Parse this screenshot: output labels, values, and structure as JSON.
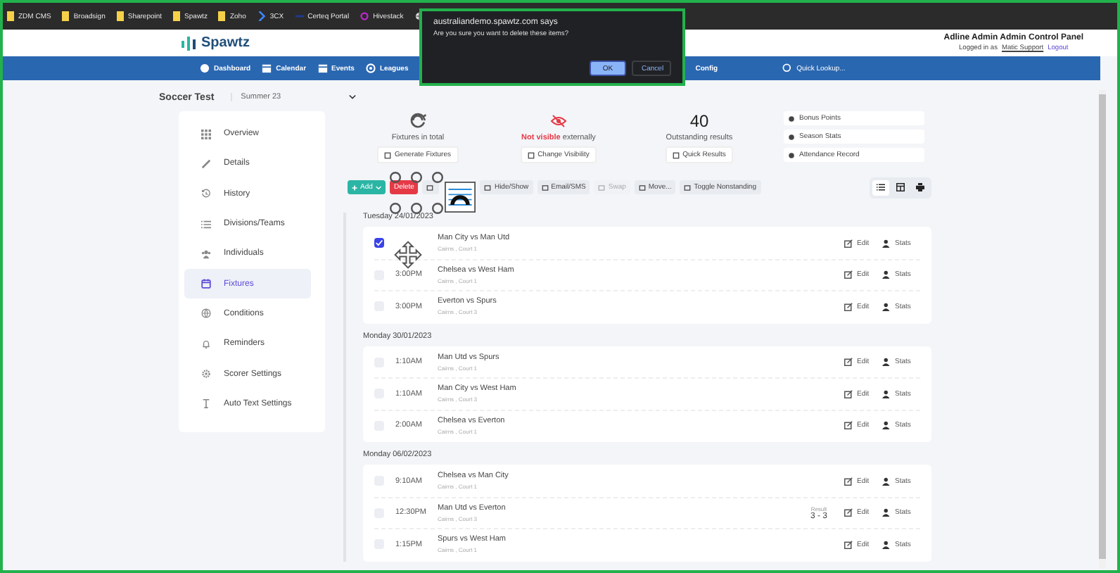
{
  "bookmarks": [
    {
      "label": "ZDM CMS",
      "kind": "folder"
    },
    {
      "label": "Broadsign",
      "kind": "folder"
    },
    {
      "label": "Sharepoint",
      "kind": "folder"
    },
    {
      "label": "Spawtz",
      "kind": "folder"
    },
    {
      "label": "Zoho",
      "kind": "folder"
    },
    {
      "label": "3CX",
      "kind": "chevron"
    },
    {
      "label": "Certeq Portal",
      "kind": "dash"
    },
    {
      "label": "Hivestack",
      "kind": "ring"
    },
    {
      "kind": "globe"
    }
  ],
  "header": {
    "logo": "Spawtz",
    "panel_title": "Adline Admin Admin Control Panel",
    "logged_prefix": "Logged in as",
    "user": "Matic Support",
    "logout": "Logout"
  },
  "nav": [
    "Dashboard",
    "Calendar",
    "Events",
    "Leagues",
    "Config",
    "Quick Lookup..."
  ],
  "dialog": {
    "origin": "australiandemo.spawtz.com says",
    "message": "Are you sure you want to delete these items?",
    "ok": "OK",
    "cancel": "Cancel"
  },
  "competition": {
    "name": "Soccer Test",
    "season": "Summer 23"
  },
  "sidebar": [
    {
      "label": "Overview",
      "selected": false
    },
    {
      "label": "Details",
      "selected": false
    },
    {
      "label": "History",
      "selected": false
    },
    {
      "label": "Divisions/Teams",
      "selected": false
    },
    {
      "label": "Individuals",
      "selected": false
    },
    {
      "label": "Fixtures",
      "selected": true
    },
    {
      "label": "Conditions",
      "selected": false
    },
    {
      "label": "Reminders",
      "selected": false
    },
    {
      "label": "Scorer Settings",
      "selected": false
    },
    {
      "label": "Auto Text Settings",
      "selected": false
    }
  ],
  "stats": [
    {
      "kind": "icon",
      "label": "Fixtures in total",
      "button": "Generate Fixtures"
    },
    {
      "kind": "visibility",
      "label": "**Not visible** externally",
      "button": "Change Visibility"
    },
    {
      "kind": "number",
      "value": "40",
      "label": "Outstanding results",
      "button": "Quick Results"
    }
  ],
  "side_links": [
    "Bonus Points",
    "Season Stats",
    "Attendance Record"
  ],
  "toolbar": [
    {
      "label": "Add",
      "kind": "add",
      "disabled": false
    },
    {
      "label": "Delete",
      "kind": "delete",
      "disabled": false
    },
    {
      "kind": "icon",
      "disabled": false
    },
    {
      "label": "Hide/Show",
      "kind": "plain",
      "disabled": false
    },
    {
      "label": "Email/SMS",
      "kind": "plain",
      "disabled": false
    },
    {
      "label": "Swap",
      "kind": "plain",
      "disabled": true
    },
    {
      "label": "Move...",
      "kind": "plain",
      "disabled": false
    },
    {
      "label": "Toggle Nonstanding",
      "kind": "plain",
      "disabled": false
    }
  ],
  "views": [
    {
      "selected": true
    },
    {
      "selected": false
    },
    {
      "selected": false
    }
  ],
  "groups": [
    {
      "date": "Tuesday 24/01/2023",
      "fixtures": [
        {
          "match": "Man City vs Man Utd",
          "location": "Cairns , Court 1",
          "checked": true,
          "edit": "Edit",
          "stats": "Stats"
        },
        {
          "time": "3:00PM",
          "match": "Chelsea vs West Ham",
          "location": "Cairns , Court 1",
          "checked": false,
          "edit": "Edit",
          "stats": "Stats"
        },
        {
          "time": "3:00PM",
          "match": "Everton vs Spurs",
          "location": "Cairns , Court 3",
          "checked": false,
          "edit": "Edit",
          "stats": "Stats"
        }
      ]
    },
    {
      "date": "Monday 30/01/2023",
      "fixtures": [
        {
          "time": "1:10AM",
          "match": "Man Utd vs Spurs",
          "location": "Cairns , Court 1",
          "checked": false,
          "edit": "Edit",
          "stats": "Stats"
        },
        {
          "time": "1:10AM",
          "match": "Man City vs West Ham",
          "location": "Cairns , Court 3",
          "checked": false,
          "edit": "Edit",
          "stats": "Stats"
        },
        {
          "time": "2:00AM",
          "match": "Chelsea vs Everton",
          "location": "Cairns , Court 1",
          "checked": false,
          "edit": "Edit",
          "stats": "Stats"
        }
      ]
    },
    {
      "date": "Monday 06/02/2023",
      "fixtures": [
        {
          "time": "9:10AM",
          "match": "Chelsea vs Man City",
          "location": "Cairns , Court 1",
          "checked": false,
          "edit": "Edit",
          "stats": "Stats"
        },
        {
          "time": "12:30PM",
          "match": "Man Utd vs Everton",
          "location": "Cairns , Court 3",
          "checked": false,
          "result_label": "Result",
          "result": "3 - 3",
          "edit": "Edit",
          "stats": "Stats"
        },
        {
          "time": "1:15PM",
          "match": "Spurs vs West Ham",
          "location": "Cairns , Court 1",
          "checked": false,
          "edit": "Edit",
          "stats": "Stats"
        }
      ]
    }
  ]
}
